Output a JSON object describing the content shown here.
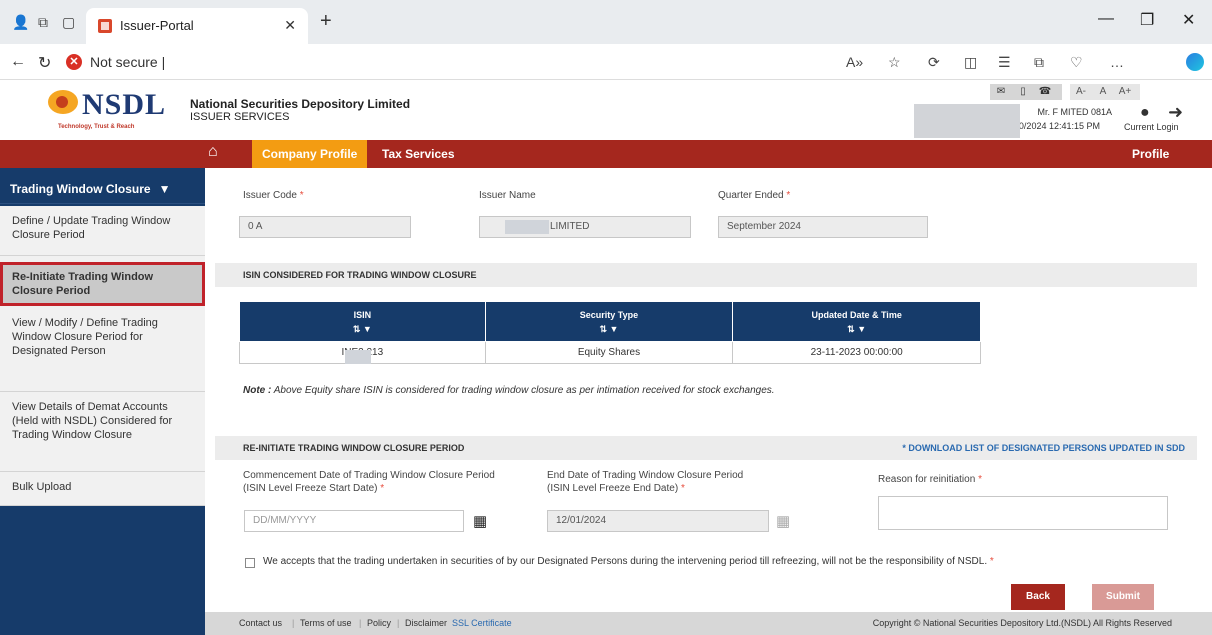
{
  "browser": {
    "tab_title": "Issuer-Portal",
    "url_status": "Not secure",
    "url_text": "|"
  },
  "header": {
    "logo_text": "NSDL",
    "logo_tagline": "Technology, Trust & Reach",
    "org_name": "National Securities Depository Limited",
    "org_sub": "ISSUER SERVICES",
    "font_buttons": [
      "A-",
      "A",
      "A+"
    ],
    "user_line1": "Mr. F                    MITED  081A",
    "user_line2": "10/2024  12:41:15 PM",
    "current_login": "Current Login"
  },
  "nav": {
    "company_profile": "Company Profile",
    "tax_services": "Tax Services",
    "profile": "Profile"
  },
  "sidebar": {
    "heading": "Trading Window Closure",
    "items": [
      {
        "label": "Define / Update Trading Window Closure Period"
      },
      {
        "label": "Re-Initiate Trading Window Closure Period"
      },
      {
        "label": "View / Modify / Define Trading Window Closure Period for Designated Person"
      },
      {
        "label": "View Details of Demat Accounts (Held with NSDL) Considered for Trading Window Closure"
      },
      {
        "label": "Bulk Upload"
      }
    ]
  },
  "form": {
    "issuer_code_label": "Issuer Code",
    "issuer_code_value": "0   A",
    "issuer_name_label": "Issuer Name",
    "issuer_name_value": "LIMITED",
    "quarter_label": "Quarter Ended",
    "quarter_value": "September 2024"
  },
  "isin_section": {
    "title": "ISIN CONSIDERED FOR TRADING WINDOW CLOSURE",
    "columns": [
      "ISIN",
      "Security Type",
      "Updated Date & Time"
    ],
    "rows": [
      [
        "INE2        213",
        "Equity Shares",
        "23-11-2023 00:00:00"
      ]
    ],
    "note_label": "Note :",
    "note_text": " Above Equity share ISIN is considered for trading window closure as per intimation received for stock exchanges."
  },
  "reinit_section": {
    "title": "RE-INITIATE TRADING WINDOW CLOSURE PERIOD",
    "download_link": "* DOWNLOAD LIST OF DESIGNATED PERSONS UPDATED IN SDD",
    "start_label_1": "Commencement Date of Trading Window Closure Period",
    "start_label_2": "(ISIN Level Freeze Start Date)",
    "start_placeholder": "DD/MM/YYYY",
    "end_label_1": "End Date of Trading Window Closure Period",
    "end_label_2": "(ISIN Level Freeze End Date)",
    "end_value": "12/01/2024",
    "reason_label": "Reason for reinitiation",
    "consent_text": "We accepts that the trading undertaken in securities of by our Designated Persons during the intervening period till refreezing, will not be the responsibility of NSDL.",
    "back": "Back",
    "submit": "Submit"
  },
  "footer": {
    "contact": "Contact us",
    "terms": "Terms of use",
    "policy": "Policy",
    "disclaimer": "Disclaimer",
    "ssl": "SSL Certificate",
    "copyright": "Copyright © National Securities Depository Ltd.(NSDL) All Rights Reserved"
  },
  "colors": {
    "brand_red": "#a5271e",
    "nav_active": "#f39c12",
    "sidebar_blue": "#163b6a",
    "link_blue": "#2a6ab0"
  }
}
